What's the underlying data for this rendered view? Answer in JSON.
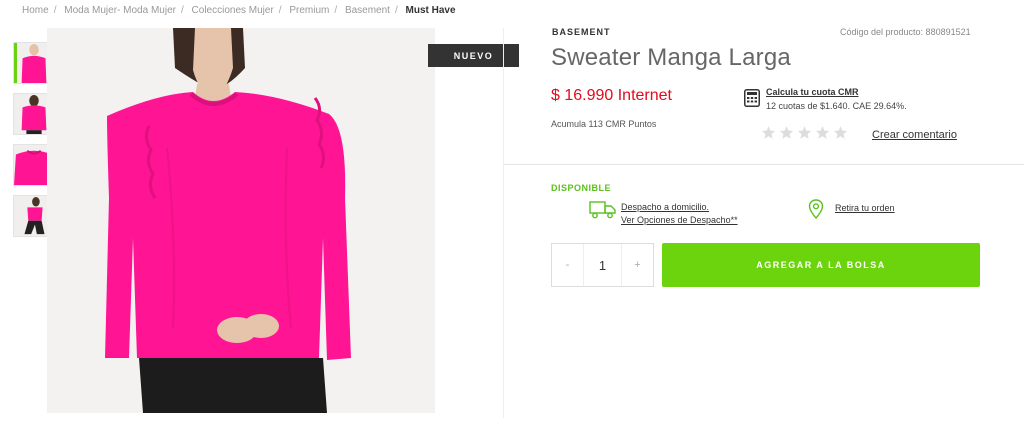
{
  "breadcrumb": {
    "items": [
      "Home",
      "Moda Mujer- Moda Mujer",
      "Colecciones Mujer",
      "Premium",
      "Basement"
    ],
    "current": "Must Have"
  },
  "gallery": {
    "badge": "NUEVO",
    "thumbnails": [
      "thumbnail-1",
      "thumbnail-2",
      "thumbnail-3",
      "thumbnail-4"
    ],
    "product_color": "#ff1493"
  },
  "product": {
    "brand": "BASEMENT",
    "sku": "Código del producto: 880891521",
    "title": "Sweater Manga Larga",
    "price": "$ 16.990 Internet",
    "points": "Acumula 113 CMR Puntos",
    "rating_stars": 0,
    "comment_link": "Crear comentario"
  },
  "cmr": {
    "icon": "calculator-icon",
    "link": "Calcula tu cuota CMR",
    "detail": "12 cuotas de $1.640. CAE 29.64%."
  },
  "availability": {
    "status": "DISPONIBLE",
    "delivery_line1": "Despacho a domicilio.",
    "delivery_line2": "Ver Opciones de Despacho**",
    "pickup": "Retira tu orden"
  },
  "cart": {
    "minus": "-",
    "quantity": "1",
    "plus": "+",
    "add_label": "AGREGAR A LA BOLSA"
  },
  "colors": {
    "price_red": "#e4091b",
    "accent_green": "#6cd40c",
    "status_green": "#5cc01e"
  }
}
